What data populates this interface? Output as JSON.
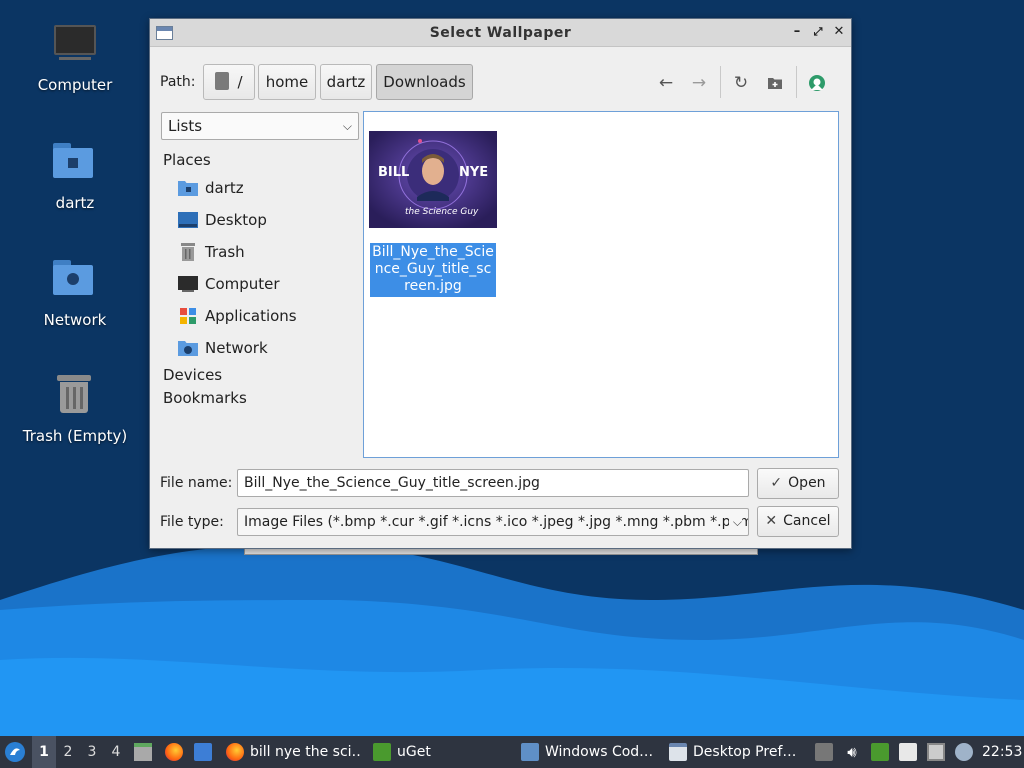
{
  "desktop": {
    "icons": [
      {
        "label": "Computer"
      },
      {
        "label": "dartz"
      },
      {
        "label": "Network"
      },
      {
        "label": "Trash (Empty)"
      }
    ]
  },
  "dialog": {
    "title": "Select Wallpaper",
    "path_label": "Path:",
    "crumbs": [
      "/",
      "home",
      "dartz",
      "Downloads"
    ],
    "view_mode": "Lists",
    "sidebar": {
      "places_heading": "Places",
      "items": [
        {
          "label": "dartz",
          "icon": "home-folder-icon"
        },
        {
          "label": "Desktop",
          "icon": "desktop-icon"
        },
        {
          "label": "Trash",
          "icon": "trash-icon"
        },
        {
          "label": "Computer",
          "icon": "computer-icon"
        },
        {
          "label": "Applications",
          "icon": "applications-icon"
        },
        {
          "label": "Network",
          "icon": "network-icon"
        }
      ],
      "devices_heading": "Devices",
      "bookmarks_heading": "Bookmarks"
    },
    "files": [
      {
        "name": "Bill_Nye_the_Science_Guy_title_screen.jpg",
        "thumb_text_1": "BILL",
        "thumb_text_2": "NYE",
        "thumb_text_3": "the Science Guy",
        "selected": true
      }
    ],
    "file_name_label": "File name:",
    "file_name_value": "Bill_Nye_the_Science_Guy_title_screen.jpg",
    "file_type_label": "File type:",
    "file_type_value": "Image Files (*.bmp *.cur *.gif *.icns *.ico *.jpeg *.jpg *.mng *.pbm *.pgm",
    "open_label": "Open",
    "cancel_label": "Cancel"
  },
  "taskbar": {
    "workspaces": [
      "1",
      "2",
      "3",
      "4"
    ],
    "active_workspace": "1",
    "tasks": [
      {
        "label": "bill nye the sci…"
      },
      {
        "label": "uGet"
      },
      {
        "label": "Windows Cod…"
      },
      {
        "label": "Desktop Pref…"
      }
    ],
    "clock": "22:53"
  },
  "colors": {
    "accent": "#3d8ee6",
    "taskbar_bg": "#2e3440",
    "desktop_bg": "#0c3562"
  }
}
